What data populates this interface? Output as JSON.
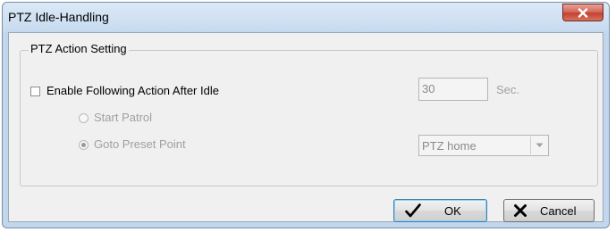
{
  "window": {
    "title": "PTZ Idle-Handling",
    "close_icon": "close-icon"
  },
  "group": {
    "legend": "PTZ Action Setting"
  },
  "enable_idle": {
    "label": "Enable Following Action After Idle",
    "checked": false
  },
  "idle_time": {
    "value": "30",
    "unit": "Sec."
  },
  "options": {
    "start_patrol": {
      "label": "Start Patrol",
      "selected": false
    },
    "goto_preset": {
      "label": "Goto Preset Point",
      "selected": true
    }
  },
  "preset_select": {
    "value": "PTZ home",
    "icon": "chevron-down-icon"
  },
  "buttons": {
    "ok": {
      "label": "OK",
      "icon": "checkmark-icon"
    },
    "cancel": {
      "label": "Cancel",
      "icon": "x-icon"
    }
  },
  "colors": {
    "title_bar": "#c9dcf0",
    "close_button": "#c2412f",
    "dialog_background": "#f0f0f0",
    "disabled_text": "#a0a0a0",
    "default_button_border": "#3c7fb1"
  }
}
